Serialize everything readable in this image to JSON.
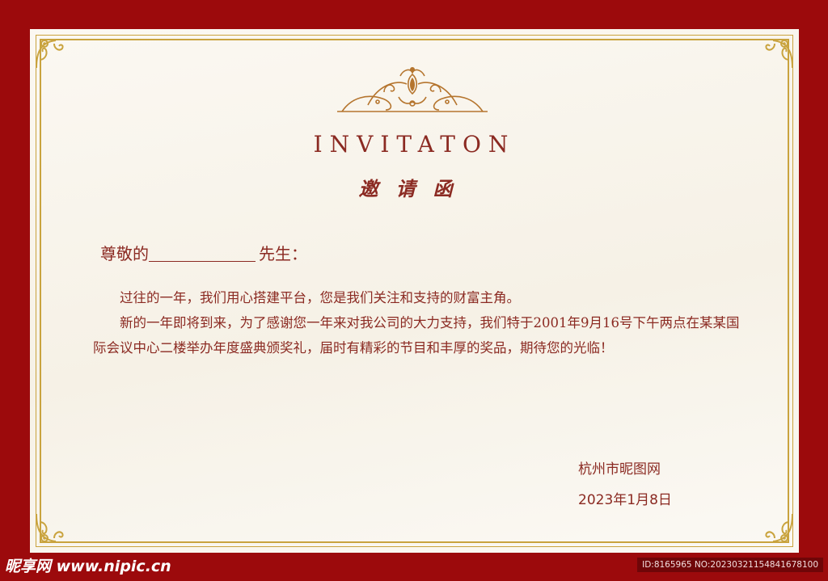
{
  "invitation": {
    "title_en": "INVITATON",
    "title_cn": "邀请函",
    "salutation_prefix": "尊敬的",
    "salutation_suffix": "先生：",
    "paragraphs": [
      "过往的一年，我们用心搭建平台，您是我们关注和支持的财富主角。",
      "新的一年即将到来，为了感谢您一年来对我公司的大力支持，我们特于2001年9月16号下午两点在某某国际会议中心二楼举办年度盛典颁奖礼，届时有精彩的节目和丰厚的奖品，期待您的光临！"
    ],
    "sender": "杭州市昵图网",
    "date": "2023年1月8日"
  },
  "watermark": {
    "site": "昵享网 www.nipic.cn",
    "id_text": "ID:8165965 NO:20230321154841678100"
  },
  "colors": {
    "background_red": "#9c0a0c",
    "gold": "#c9a33e",
    "text_red": "#8b2a22"
  },
  "icons": [
    "corner-ornament-icon",
    "crest-ornament-icon"
  ]
}
